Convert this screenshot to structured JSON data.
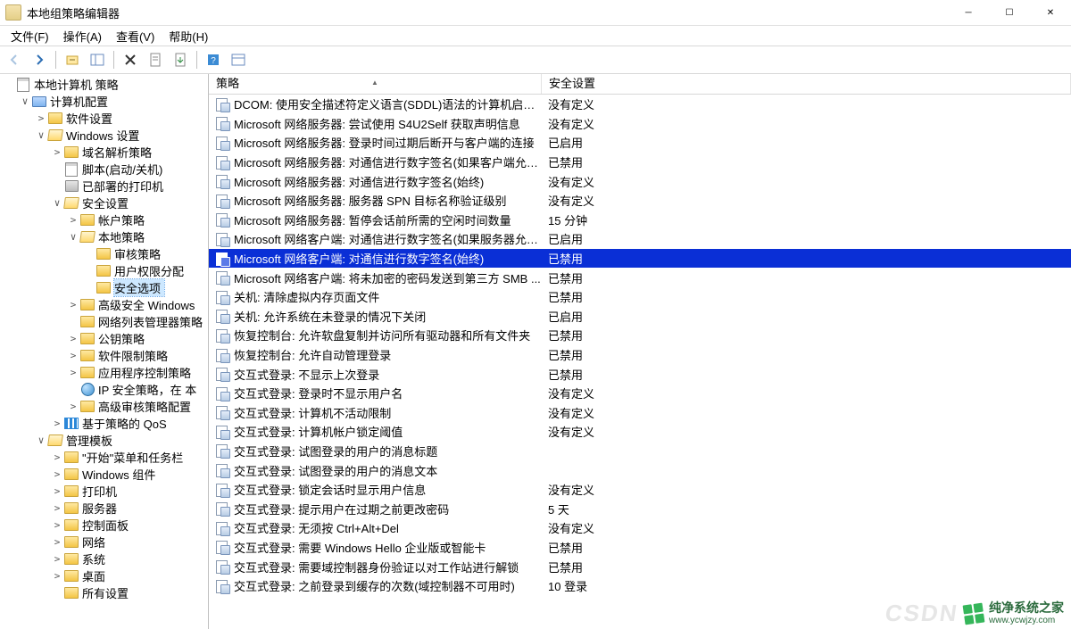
{
  "window": {
    "title": "本地组策略编辑器"
  },
  "menu": {
    "items": [
      "文件(F)",
      "操作(A)",
      "查看(V)",
      "帮助(H)"
    ]
  },
  "tree": {
    "root": {
      "label": "本地计算机 策略",
      "iconCls": "note"
    },
    "nodes": [
      {
        "indent": 1,
        "twisty": "▾",
        "iconCls": "comp",
        "label": "计算机配置"
      },
      {
        "indent": 2,
        "twisty": "▸",
        "iconCls": "fld",
        "label": "软件设置"
      },
      {
        "indent": 2,
        "twisty": "▾",
        "iconCls": "fld-open",
        "label": "Windows 设置"
      },
      {
        "indent": 3,
        "twisty": "▸",
        "iconCls": "fld",
        "label": "域名解析策略"
      },
      {
        "indent": 3,
        "twisty": " ",
        "iconCls": "note",
        "label": "脚本(启动/关机)"
      },
      {
        "indent": 3,
        "twisty": " ",
        "iconCls": "pc",
        "label": "已部署的打印机"
      },
      {
        "indent": 3,
        "twisty": "▾",
        "iconCls": "fld-open",
        "label": "安全设置"
      },
      {
        "indent": 4,
        "twisty": "▸",
        "iconCls": "fld",
        "label": "帐户策略"
      },
      {
        "indent": 4,
        "twisty": "▾",
        "iconCls": "fld-open",
        "label": "本地策略"
      },
      {
        "indent": 5,
        "twisty": " ",
        "iconCls": "fld",
        "label": "审核策略"
      },
      {
        "indent": 5,
        "twisty": " ",
        "iconCls": "fld",
        "label": "用户权限分配"
      },
      {
        "indent": 5,
        "twisty": " ",
        "iconCls": "fld",
        "label": "安全选项",
        "selected": true
      },
      {
        "indent": 4,
        "twisty": "▸",
        "iconCls": "fld",
        "label": "高级安全 Windows"
      },
      {
        "indent": 4,
        "twisty": " ",
        "iconCls": "fld",
        "label": "网络列表管理器策略"
      },
      {
        "indent": 4,
        "twisty": "▸",
        "iconCls": "fld",
        "label": "公钥策略"
      },
      {
        "indent": 4,
        "twisty": "▸",
        "iconCls": "fld",
        "label": "软件限制策略"
      },
      {
        "indent": 4,
        "twisty": "▸",
        "iconCls": "fld",
        "label": "应用程序控制策略"
      },
      {
        "indent": 4,
        "twisty": " ",
        "iconCls": "globe",
        "label": "IP 安全策略，在 本"
      },
      {
        "indent": 4,
        "twisty": "▸",
        "iconCls": "fld",
        "label": "高级审核策略配置"
      },
      {
        "indent": 3,
        "twisty": "▸",
        "iconCls": "chart",
        "label": "基于策略的 QoS"
      },
      {
        "indent": 2,
        "twisty": "▾",
        "iconCls": "fld-open",
        "label": "管理模板"
      },
      {
        "indent": 3,
        "twisty": "▸",
        "iconCls": "fld",
        "label": "\"开始\"菜单和任务栏"
      },
      {
        "indent": 3,
        "twisty": "▸",
        "iconCls": "fld",
        "label": "Windows 组件"
      },
      {
        "indent": 3,
        "twisty": "▸",
        "iconCls": "fld",
        "label": "打印机"
      },
      {
        "indent": 3,
        "twisty": "▸",
        "iconCls": "fld",
        "label": "服务器"
      },
      {
        "indent": 3,
        "twisty": "▸",
        "iconCls": "fld",
        "label": "控制面板"
      },
      {
        "indent": 3,
        "twisty": "▸",
        "iconCls": "fld",
        "label": "网络"
      },
      {
        "indent": 3,
        "twisty": "▸",
        "iconCls": "fld",
        "label": "系统"
      },
      {
        "indent": 3,
        "twisty": "▸",
        "iconCls": "fld",
        "label": "桌面"
      },
      {
        "indent": 3,
        "twisty": " ",
        "iconCls": "fld",
        "label": "所有设置"
      }
    ]
  },
  "list": {
    "headers": {
      "policy": "策略",
      "setting": "安全设置"
    },
    "rows": [
      {
        "policy": "DCOM: 使用安全描述符定义语言(SDDL)语法的计算机启动...",
        "setting": "没有定义"
      },
      {
        "policy": "Microsoft 网络服务器: 尝试使用 S4U2Self 获取声明信息",
        "setting": "没有定义"
      },
      {
        "policy": "Microsoft 网络服务器: 登录时间过期后断开与客户端的连接",
        "setting": "已启用"
      },
      {
        "policy": "Microsoft 网络服务器: 对通信进行数字签名(如果客户端允许)",
        "setting": "已禁用"
      },
      {
        "policy": "Microsoft 网络服务器: 对通信进行数字签名(始终)",
        "setting": "没有定义"
      },
      {
        "policy": "Microsoft 网络服务器: 服务器 SPN 目标名称验证级别",
        "setting": "没有定义"
      },
      {
        "policy": "Microsoft 网络服务器: 暂停会话前所需的空闲时间数量",
        "setting": "15 分钟"
      },
      {
        "policy": "Microsoft 网络客户端: 对通信进行数字签名(如果服务器允许)",
        "setting": "已启用"
      },
      {
        "policy": "Microsoft 网络客户端: 对通信进行数字签名(始终)",
        "setting": "已禁用",
        "selected": true
      },
      {
        "policy": "Microsoft 网络客户端: 将未加密的密码发送到第三方 SMB ...",
        "setting": "已禁用"
      },
      {
        "policy": "关机: 清除虚拟内存页面文件",
        "setting": "已禁用"
      },
      {
        "policy": "关机: 允许系统在未登录的情况下关闭",
        "setting": "已启用"
      },
      {
        "policy": "恢复控制台: 允许软盘复制并访问所有驱动器和所有文件夹",
        "setting": "已禁用"
      },
      {
        "policy": "恢复控制台: 允许自动管理登录",
        "setting": "已禁用"
      },
      {
        "policy": "交互式登录: 不显示上次登录",
        "setting": "已禁用"
      },
      {
        "policy": "交互式登录: 登录时不显示用户名",
        "setting": "没有定义"
      },
      {
        "policy": "交互式登录: 计算机不活动限制",
        "setting": "没有定义"
      },
      {
        "policy": "交互式登录: 计算机帐户锁定阈值",
        "setting": "没有定义"
      },
      {
        "policy": "交互式登录: 试图登录的用户的消息标题",
        "setting": ""
      },
      {
        "policy": "交互式登录: 试图登录的用户的消息文本",
        "setting": ""
      },
      {
        "policy": "交互式登录: 锁定会话时显示用户信息",
        "setting": "没有定义"
      },
      {
        "policy": "交互式登录: 提示用户在过期之前更改密码",
        "setting": "5 天"
      },
      {
        "policy": "交互式登录: 无须按 Ctrl+Alt+Del",
        "setting": "没有定义"
      },
      {
        "policy": "交互式登录: 需要 Windows Hello 企业版或智能卡",
        "setting": "已禁用"
      },
      {
        "policy": "交互式登录: 需要域控制器身份验证以对工作站进行解锁",
        "setting": "已禁用"
      },
      {
        "policy": "交互式登录: 之前登录到缓存的次数(域控制器不可用时)",
        "setting": "10 登录"
      }
    ]
  },
  "watermark": {
    "csdn": "CSDN",
    "brand": "纯净系统之家",
    "url": "www.ycwjzy.com"
  }
}
